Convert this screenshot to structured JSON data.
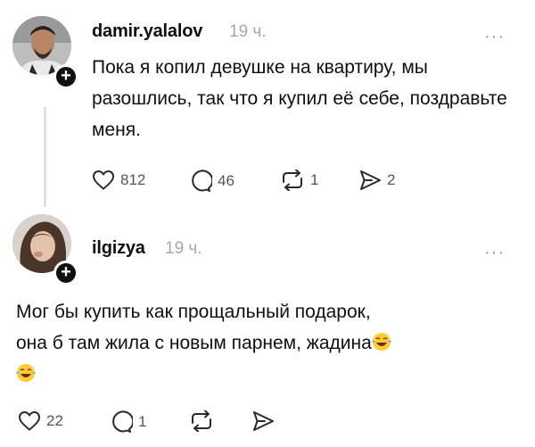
{
  "posts": [
    {
      "username": "damir.yalalov",
      "time": "19 ч.",
      "text": "Пока я копил девушке на квартиру, мы разошлись, так что я купил её себе, поздравьте меня.",
      "likes": "812",
      "replies": "46",
      "reposts": "1",
      "shares": "2"
    },
    {
      "username": "ilgizya",
      "time": "19 ч.",
      "text_line1": "Мог бы купить как прощальный подарок,",
      "text_line2": "она б там жила с новым парнем, жадина",
      "likes": "22",
      "replies": "1"
    }
  ],
  "icons": {
    "more": "more-horizontal-icon",
    "like": "heart-icon",
    "reply": "comment-bubble-icon",
    "repost": "repost-icon",
    "share": "send-icon",
    "follow": "plus-icon",
    "emoji": "laughing-tears-emoji"
  },
  "more_glyph": "···"
}
